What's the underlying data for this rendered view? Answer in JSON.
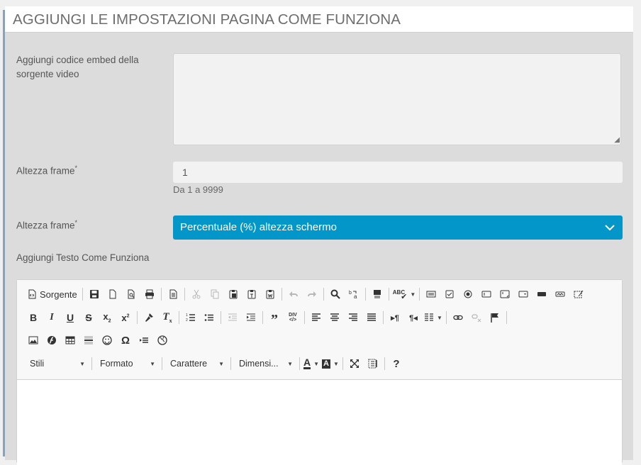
{
  "header": {
    "title": "AGGIUNGI LE IMPOSTAZIONI PAGINA COME FUNZIONA"
  },
  "form": {
    "embed_label_line1": "Aggiungi codice embed della",
    "embed_label_line2": "sorgente video",
    "embed_value": "",
    "height_label": "Altezza frame",
    "required_mark": "*",
    "height_value": "1",
    "height_hint": "Da 1 a 9999",
    "unit_label": "Altezza frame",
    "unit_selected": "Percentuale (%) altezza schermo",
    "text_label": "Aggiungi Testo Come Funziona"
  },
  "editor": {
    "source_label": "Sorgente",
    "spell_label": "ABC",
    "div_label": "DIV",
    "combos": {
      "styles": "Stili",
      "format": "Formato",
      "font": "Carattere",
      "size": "Dimensi..."
    },
    "help": "?"
  },
  "colors": {
    "accent": "#0397c9",
    "panel": "#dcdcdc",
    "header_text": "#6d6d6d"
  }
}
